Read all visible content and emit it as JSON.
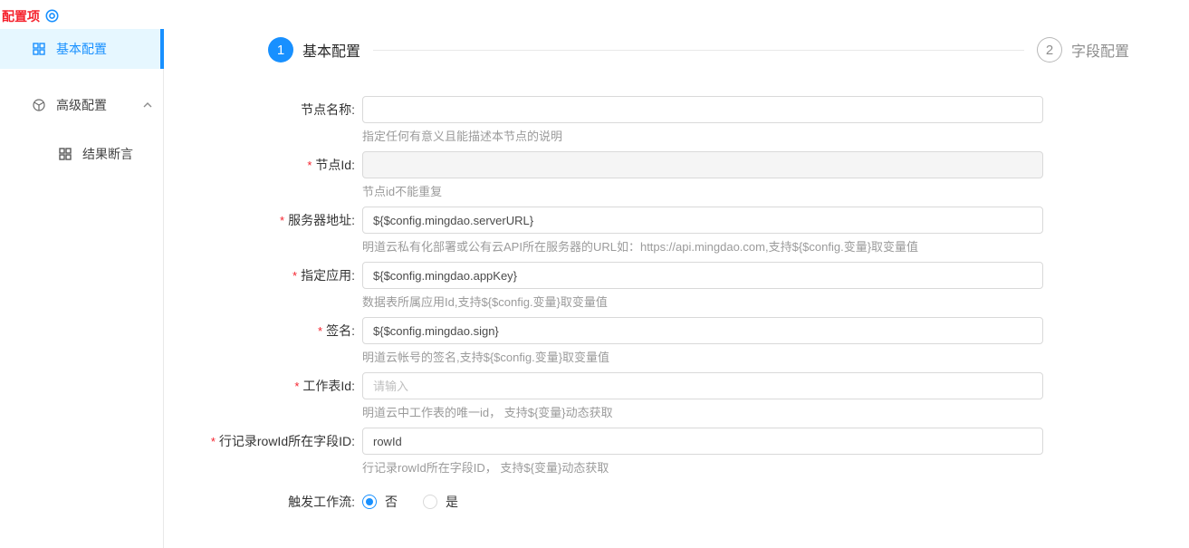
{
  "colors": {
    "accent": "#1890ff",
    "active_bg": "#e6f7ff",
    "danger": "#f5222d",
    "hint": "#9b9b9b",
    "border": "#d9d9d9",
    "disabled_bg": "#f5f5f5"
  },
  "sidebar": {
    "title": "配置项",
    "title_icon": "aim-icon",
    "items": [
      {
        "label": "基本配置",
        "icon": "grid-icon",
        "active": true
      },
      {
        "label": "高级配置",
        "icon": "cube-icon",
        "collapsed_icon": "chevron-up-icon"
      },
      {
        "label": "结果断言",
        "icon": "grid-icon",
        "child": true
      }
    ]
  },
  "steps": [
    {
      "number": "1",
      "label": "基本配置",
      "state": "active"
    },
    {
      "number": "2",
      "label": "字段配置",
      "state": "waiting"
    }
  ],
  "form": {
    "required_mark": "*",
    "fields": [
      {
        "label": "节点名称:",
        "value": "",
        "hint": "指定任何有意义且能描述本节点的说明",
        "required": false
      },
      {
        "label": "节点Id:",
        "value": "",
        "hint": "节点id不能重复",
        "required": true,
        "disabled": true
      },
      {
        "label": "服务器地址:",
        "value": "${$config.mingdao.serverURL}",
        "hint": "明道云私有化部署或公有云API所在服务器的URL如：https://api.mingdao.com,支持${$config.变量}取变量值",
        "required": true
      },
      {
        "label": "指定应用:",
        "value": "${$config.mingdao.appKey}",
        "hint": "数据表所属应用Id,支持${$config.变量}取变量值",
        "required": true
      },
      {
        "label": "签名:",
        "value": "${$config.mingdao.sign}",
        "hint": "明道云帐号的签名,支持${$config.变量}取变量值",
        "required": true
      },
      {
        "label": "工作表Id:",
        "value": "",
        "placeholder": "请输入",
        "hint": "明道云中工作表的唯一id， 支持${变量}动态获取",
        "required": true
      },
      {
        "label": "行记录rowId所在字段ID:",
        "value": "rowId",
        "hint": "行记录rowId所在字段ID， 支持${变量}动态获取",
        "required": true
      }
    ],
    "radio_field": {
      "label": "触发工作流:",
      "options": [
        {
          "label": "否",
          "selected": true
        },
        {
          "label": "是",
          "selected": false
        }
      ]
    }
  }
}
